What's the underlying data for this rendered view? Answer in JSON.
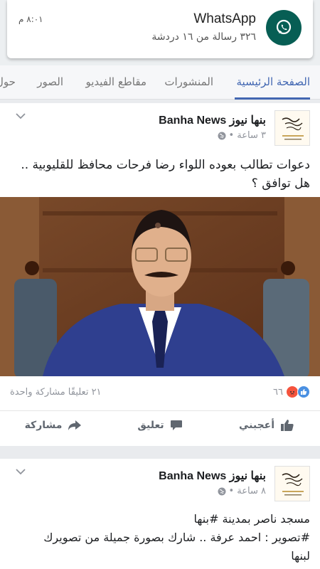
{
  "notification": {
    "app_name": "WhatsApp",
    "body": "٣٢٦ رسالة من ١٦ دردشة",
    "time": "٨:٠١ م",
    "icon": "whatsapp-icon"
  },
  "tabs": [
    {
      "label": "الصفحة الرئيسية",
      "active": true
    },
    {
      "label": "المنشورات",
      "active": false
    },
    {
      "label": "مقاطع الفيديو",
      "active": false
    },
    {
      "label": "الصور",
      "active": false
    },
    {
      "label": "حول",
      "active": false
    }
  ],
  "posts": [
    {
      "page_name": "بنها نيوز Banha News",
      "time": "٣ ساعة •",
      "text_line1": "دعوات تطالب بعوده اللواء رضا فرحات محافظ للقليوبية ..",
      "text_line2": "هل توافق ؟",
      "reaction_count": "٦٦",
      "comments_shares": "٢١ تعليقًا مشاركة واحدة",
      "actions": {
        "like": "أعجبني",
        "comment": "تعليق",
        "share": "مشاركة"
      }
    },
    {
      "page_name": "بنها نيوز Banha News",
      "time": "٨ ساعة •",
      "text_line1": "مسجد ناصر بمدينة #بنها",
      "text_line2": "#تصوير : احمد عرفة .. شارك بصورة جميلة من تصويرك",
      "text_line3": "لبنها"
    }
  ],
  "colors": {
    "accent": "#4267b2",
    "whatsapp": "#075e54"
  }
}
